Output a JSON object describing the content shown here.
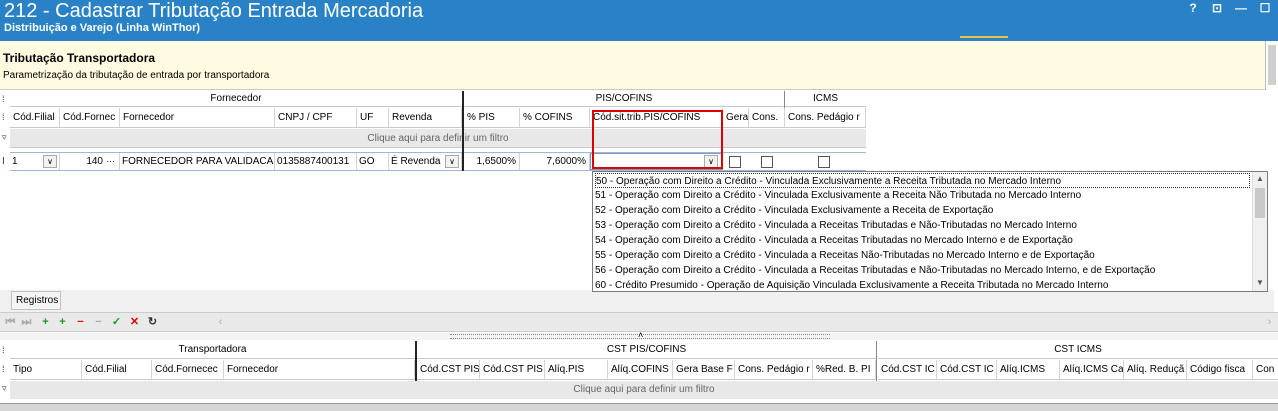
{
  "window": {
    "title": "212 - Cadastrar Tributação Entrada Mercadoria",
    "subtitle": "Distribuição e Varejo (Linha WinThor)",
    "controls": [
      "?",
      "⊡",
      "—",
      "☐"
    ]
  },
  "header": {
    "title": "Tributação Transportadora",
    "description": "Parametrização da tributação de entrada por transportadora"
  },
  "grid1": {
    "bands": {
      "fornecedor": "Fornecedor",
      "pis_cofins": "PIS/COFINS",
      "icms": "ICMS"
    },
    "columns": [
      "Cód.Filial",
      "Cód.Fornec",
      "Fornecedor",
      "CNPJ / CPF",
      "UF",
      "Revenda",
      "% PIS",
      "% COFINS",
      "Cód.sit.trib.PIS/COFINS",
      "Gera",
      "Cons.",
      "Cons. Pedágio r"
    ],
    "filter": "Clique aqui para definir um filtro",
    "row": {
      "indicator": "I",
      "cod_filial": "1",
      "cod_fornec": "140",
      "fornecedor": "FORNECEDOR PARA VALIDACA",
      "cnpj": "0135887400131",
      "uf": "GO",
      "revenda": "É Revenda",
      "pis": "1,6500%",
      "cofins": "7,6000%",
      "cst": ""
    }
  },
  "dropdown": {
    "items": [
      "50 - Operação com Direito a Crédito - Vinculada Exclusivamente a Receita Tributada no Mercado Interno",
      "51 - Operação com Direito a Crédito - Vinculada Exclusivamente a Receita Não Tributada no Mercado Interno",
      "52 - Operação com Direito a Crédito - Vinculada Exclusivamente a Receita de Exportação",
      "53 - Operação com Direito a Crédito - Vinculada a Receitas Tributadas e Não-Tributadas no Mercado Interno",
      "54 - Operação com Direito a Crédito - Vinculada a Receitas Tributadas no Mercado Interno e de Exportação",
      "55 - Operação com Direito a Crédito - Vinculada a Receitas Não-Tributadas no Mercado Interno e de Exportação",
      "56 - Operação com Direito a Crédito - Vinculada a Receitas Tributadas e Não-Tributadas no Mercado Interno, e de Exportação",
      "60 - Crédito Presumido - Operação de Aquisição Vinculada Exclusivamente a Receita Tributada no Mercado Interno"
    ]
  },
  "registros": "Registros",
  "grid2": {
    "bands": {
      "transportadora": "Transportadora",
      "cst_pis_cofins": "CST PIS/COFINS",
      "cst_icms": "CST ICMS"
    },
    "columns": [
      "Tipo",
      "Cód.Filial",
      "Cód.Fornecec",
      "Fornecedor",
      "Cód.CST PIS",
      "Cód.CST PIS",
      "Alíq.PIS",
      "Alíq.COFINS",
      "Gera Base F",
      "Cons. Pedágio r",
      "%Red. B. PI",
      "Cód.CST IC",
      "Cód.CST IC",
      "Alíq.ICMS",
      "Alíq.ICMS Ca",
      "Alíq. Reduçã",
      "Código fisca",
      "Con"
    ],
    "filter": "Clique aqui para definir um filtro"
  },
  "colors": {
    "titlebar": "#2a82c6",
    "header_bg": "#fffbe0",
    "highlight": "#e00000"
  }
}
